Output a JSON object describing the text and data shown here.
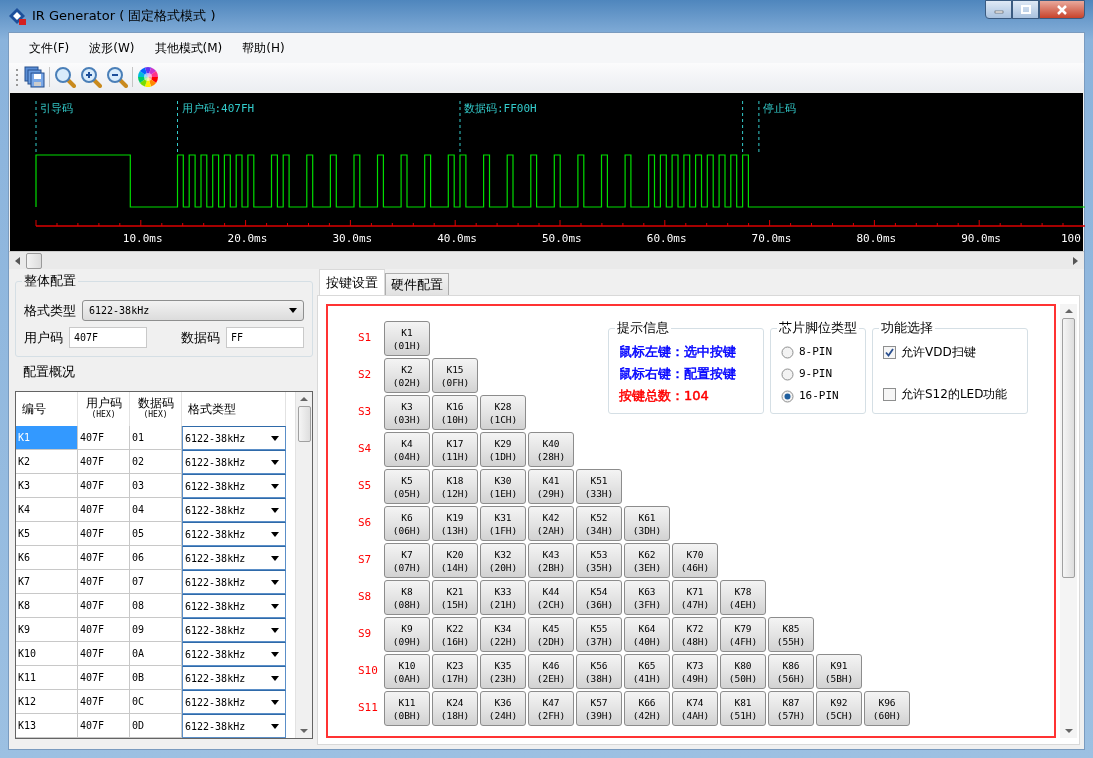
{
  "window": {
    "title": "IR Generator ( 固定格式模式 )"
  },
  "menu": [
    {
      "label": "文件(F)"
    },
    {
      "label": "波形(W)"
    },
    {
      "label": "其他模式(M)"
    },
    {
      "label": "帮助(H)"
    }
  ],
  "waveform": {
    "markers": [
      {
        "label": "引导码"
      },
      {
        "label": "用户码:407FH"
      },
      {
        "label": "数据码:FF00H"
      },
      {
        "label": "停止码"
      }
    ],
    "axis_labels": [
      "10.0ms",
      "20.0ms",
      "30.0ms",
      "40.0ms",
      "50.0ms",
      "60.0ms",
      "70.0ms",
      "80.0ms",
      "90.0ms",
      "100"
    ]
  },
  "overall_config": {
    "title": "整体配置",
    "format_label": "格式类型",
    "format_value": "6122-38kHz",
    "user_code_label": "用户码",
    "user_code": "407F",
    "data_code_label": "数据码",
    "data_code": "FF"
  },
  "summary": {
    "title": "配置概况",
    "columns": [
      {
        "label": "编号"
      },
      {
        "label": "用户码",
        "sub": "(HEX)"
      },
      {
        "label": "数据码",
        "sub": "(HEX)"
      },
      {
        "label": "格式类型"
      }
    ],
    "rows": [
      {
        "id": "K1",
        "user_code": "407F",
        "data_code": "01",
        "format": "6122-38kHz",
        "selected": true
      },
      {
        "id": "K2",
        "user_code": "407F",
        "data_code": "02",
        "format": "6122-38kHz",
        "selected": false
      },
      {
        "id": "K3",
        "user_code": "407F",
        "data_code": "03",
        "format": "6122-38kHz",
        "selected": false
      },
      {
        "id": "K4",
        "user_code": "407F",
        "data_code": "04",
        "format": "6122-38kHz",
        "selected": false
      },
      {
        "id": "K5",
        "user_code": "407F",
        "data_code": "05",
        "format": "6122-38kHz",
        "selected": false
      },
      {
        "id": "K6",
        "user_code": "407F",
        "data_code": "06",
        "format": "6122-38kHz",
        "selected": false
      },
      {
        "id": "K7",
        "user_code": "407F",
        "data_code": "07",
        "format": "6122-38kHz",
        "selected": false
      },
      {
        "id": "K8",
        "user_code": "407F",
        "data_code": "08",
        "format": "6122-38kHz",
        "selected": false
      },
      {
        "id": "K9",
        "user_code": "407F",
        "data_code": "09",
        "format": "6122-38kHz",
        "selected": false
      },
      {
        "id": "K10",
        "user_code": "407F",
        "data_code": "0A",
        "format": "6122-38kHz",
        "selected": false
      },
      {
        "id": "K11",
        "user_code": "407F",
        "data_code": "0B",
        "format": "6122-38kHz",
        "selected": false
      },
      {
        "id": "K12",
        "user_code": "407F",
        "data_code": "0C",
        "format": "6122-38kHz",
        "selected": false
      },
      {
        "id": "K13",
        "user_code": "407F",
        "data_code": "0D",
        "format": "6122-38kHz",
        "selected": false
      }
    ]
  },
  "tabs": [
    {
      "label": "按键设置",
      "selected": true
    },
    {
      "label": "硬件配置",
      "selected": false
    }
  ],
  "key_rows": [
    {
      "label": "S1",
      "keys": [
        {
          "name": "K1",
          "code": "(01H)"
        }
      ]
    },
    {
      "label": "S2",
      "keys": [
        {
          "name": "K2",
          "code": "(02H)"
        },
        {
          "name": "K15",
          "code": "(0FH)"
        }
      ]
    },
    {
      "label": "S3",
      "keys": [
        {
          "name": "K3",
          "code": "(03H)"
        },
        {
          "name": "K16",
          "code": "(10H)"
        },
        {
          "name": "K28",
          "code": "(1CH)"
        }
      ]
    },
    {
      "label": "S4",
      "keys": [
        {
          "name": "K4",
          "code": "(04H)"
        },
        {
          "name": "K17",
          "code": "(11H)"
        },
        {
          "name": "K29",
          "code": "(1DH)"
        },
        {
          "name": "K40",
          "code": "(28H)"
        }
      ]
    },
    {
      "label": "S5",
      "keys": [
        {
          "name": "K5",
          "code": "(05H)"
        },
        {
          "name": "K18",
          "code": "(12H)"
        },
        {
          "name": "K30",
          "code": "(1EH)"
        },
        {
          "name": "K41",
          "code": "(29H)"
        },
        {
          "name": "K51",
          "code": "(33H)"
        }
      ]
    },
    {
      "label": "S6",
      "keys": [
        {
          "name": "K6",
          "code": "(06H)"
        },
        {
          "name": "K19",
          "code": "(13H)"
        },
        {
          "name": "K31",
          "code": "(1FH)"
        },
        {
          "name": "K42",
          "code": "(2AH)"
        },
        {
          "name": "K52",
          "code": "(34H)"
        },
        {
          "name": "K61",
          "code": "(3DH)"
        }
      ]
    },
    {
      "label": "S7",
      "keys": [
        {
          "name": "K7",
          "code": "(07H)"
        },
        {
          "name": "K20",
          "code": "(14H)"
        },
        {
          "name": "K32",
          "code": "(20H)"
        },
        {
          "name": "K43",
          "code": "(2BH)"
        },
        {
          "name": "K53",
          "code": "(35H)"
        },
        {
          "name": "K62",
          "code": "(3EH)"
        },
        {
          "name": "K70",
          "code": "(46H)"
        }
      ]
    },
    {
      "label": "S8",
      "keys": [
        {
          "name": "K8",
          "code": "(08H)"
        },
        {
          "name": "K21",
          "code": "(15H)"
        },
        {
          "name": "K33",
          "code": "(21H)"
        },
        {
          "name": "K44",
          "code": "(2CH)"
        },
        {
          "name": "K54",
          "code": "(36H)"
        },
        {
          "name": "K63",
          "code": "(3FH)"
        },
        {
          "name": "K71",
          "code": "(47H)"
        },
        {
          "name": "K78",
          "code": "(4EH)"
        }
      ]
    },
    {
      "label": "S9",
      "keys": [
        {
          "name": "K9",
          "code": "(09H)"
        },
        {
          "name": "K22",
          "code": "(16H)"
        },
        {
          "name": "K34",
          "code": "(22H)"
        },
        {
          "name": "K45",
          "code": "(2DH)"
        },
        {
          "name": "K55",
          "code": "(37H)"
        },
        {
          "name": "K64",
          "code": "(40H)"
        },
        {
          "name": "K72",
          "code": "(48H)"
        },
        {
          "name": "K79",
          "code": "(4FH)"
        },
        {
          "name": "K85",
          "code": "(55H)"
        }
      ]
    },
    {
      "label": "S10",
      "keys": [
        {
          "name": "K10",
          "code": "(0AH)"
        },
        {
          "name": "K23",
          "code": "(17H)"
        },
        {
          "name": "K35",
          "code": "(23H)"
        },
        {
          "name": "K46",
          "code": "(2EH)"
        },
        {
          "name": "K56",
          "code": "(38H)"
        },
        {
          "name": "K65",
          "code": "(41H)"
        },
        {
          "name": "K73",
          "code": "(49H)"
        },
        {
          "name": "K80",
          "code": "(50H)"
        },
        {
          "name": "K86",
          "code": "(56H)"
        },
        {
          "name": "K91",
          "code": "(5BH)"
        }
      ]
    },
    {
      "label": "S11",
      "keys": [
        {
          "name": "K11",
          "code": "(0BH)"
        },
        {
          "name": "K24",
          "code": "(18H)"
        },
        {
          "name": "K36",
          "code": "(24H)"
        },
        {
          "name": "K47",
          "code": "(2FH)"
        },
        {
          "name": "K57",
          "code": "(39H)"
        },
        {
          "name": "K66",
          "code": "(42H)"
        },
        {
          "name": "K74",
          "code": "(4AH)"
        },
        {
          "name": "K81",
          "code": "(51H)"
        },
        {
          "name": "K87",
          "code": "(57H)"
        },
        {
          "name": "K92",
          "code": "(5CH)"
        },
        {
          "name": "K96",
          "code": "(60H)"
        }
      ]
    }
  ],
  "hints": {
    "title": "提示信息",
    "lines": [
      {
        "text": "鼠标左键：选中按键",
        "color": "#0000ff"
      },
      {
        "text": "鼠标右键：配置按键",
        "color": "#0000ff"
      },
      {
        "text": "按键总数：104",
        "color": "#ff0000"
      }
    ]
  },
  "pin_type": {
    "title": "芯片脚位类型",
    "options": [
      {
        "label": "8-PIN",
        "selected": false
      },
      {
        "label": "9-PIN",
        "selected": false
      },
      {
        "label": "16-PIN",
        "selected": true
      }
    ]
  },
  "functions": {
    "title": "功能选择",
    "options": [
      {
        "label": "允许VDD扫键",
        "checked": true
      },
      {
        "label": "允许S12的LED功能",
        "checked": false
      }
    ]
  }
}
